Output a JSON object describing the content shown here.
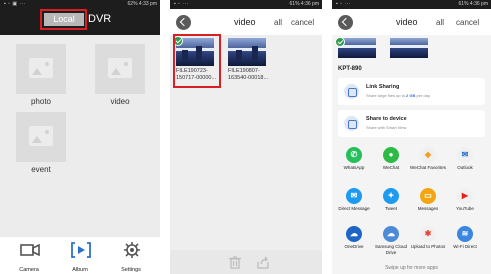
{
  "phone1": {
    "status_right": "62% 4:33 pm",
    "tabs": {
      "local": "Local",
      "dvr": "DVR"
    },
    "folders": [
      "photo",
      "video",
      "event"
    ],
    "nav": {
      "camera": "Camera",
      "album": "Album",
      "settings": "Settings"
    },
    "colors": {
      "highlight": "#d81f26",
      "header": "#1d1d1d"
    }
  },
  "phone2": {
    "status_right": "61% 4:36 pm",
    "header": {
      "title": "video",
      "all": "all",
      "cancel": "cancel"
    },
    "files": [
      {
        "name_line1": "FILE190723-",
        "name_line2": "150717-00000..."
      },
      {
        "name_line1": "FILE190807-",
        "name_line2": "163540-00018..."
      }
    ]
  },
  "phone3": {
    "status_right": "61% 4:36 pm",
    "header": {
      "title": "video",
      "all": "all",
      "cancel": "cancel"
    },
    "device": "KPT-890",
    "link_sharing": {
      "title": "Link Sharing",
      "sub_pre": "Share large files up to",
      "sub_size": "2 GB",
      "sub_post": "per day."
    },
    "share_device": {
      "title": "Share to device",
      "sub": "Share with Smart View"
    },
    "apps": [
      {
        "label": "WhatsApp",
        "icon": "whatsapp-icon",
        "color": "#25c05a"
      },
      {
        "label": "WeChat",
        "icon": "wechat-icon",
        "color": "#2dbb45"
      },
      {
        "label": "WeChat Favorites",
        "icon": "wechat-favorites-icon",
        "color": "#f0f0f0"
      },
      {
        "label": "Outlook",
        "icon": "outlook-icon",
        "color": "#1e6fd0"
      },
      {
        "label": "Direct Message",
        "icon": "twitter-dm-icon",
        "color": "#1d9bf0"
      },
      {
        "label": "Tweet",
        "icon": "twitter-icon",
        "color": "#1d9bf0"
      },
      {
        "label": "Messages",
        "icon": "messages-icon",
        "color": "#f3a614"
      },
      {
        "label": "YouTube",
        "icon": "youtube-icon",
        "color": "#e62117"
      },
      {
        "label": "OneDrive",
        "icon": "onedrive-icon",
        "color": "#1d66c8"
      },
      {
        "label": "Samsung Cloud Drive",
        "icon": "samsung-cloud-icon",
        "color": "#4d8ad8"
      },
      {
        "label": "Upload to Photos",
        "icon": "google-photos-icon",
        "color": "#f0f0f0"
      },
      {
        "label": "Wi-Fi Direct",
        "icon": "wifi-direct-icon",
        "color": "#3a86e0"
      }
    ],
    "swipe_hint": "Swipe up for more apps"
  }
}
